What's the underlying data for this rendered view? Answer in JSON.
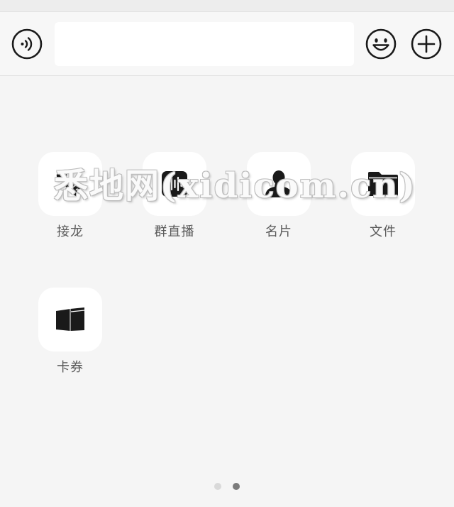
{
  "input_bar": {
    "text_value": "",
    "voice_icon": "voice-input-icon",
    "emoji_icon": "emoji-icon",
    "plus_icon": "plus-icon"
  },
  "apps": [
    {
      "label": "接龙",
      "icon": "jielong-icon"
    },
    {
      "label": "群直播",
      "icon": "group-live-icon"
    },
    {
      "label": "名片",
      "icon": "contact-card-icon"
    },
    {
      "label": "文件",
      "icon": "folder-icon"
    },
    {
      "label": "卡券",
      "icon": "card-coupon-icon"
    }
  ],
  "watermark": "悉地网(xidicom.cn)",
  "pager": {
    "pages": 2,
    "current": 2
  },
  "colors": {
    "background": "#f5f5f5",
    "tile": "#ffffff",
    "label": "#5a5a5a",
    "icon": "#1a1a1a"
  }
}
